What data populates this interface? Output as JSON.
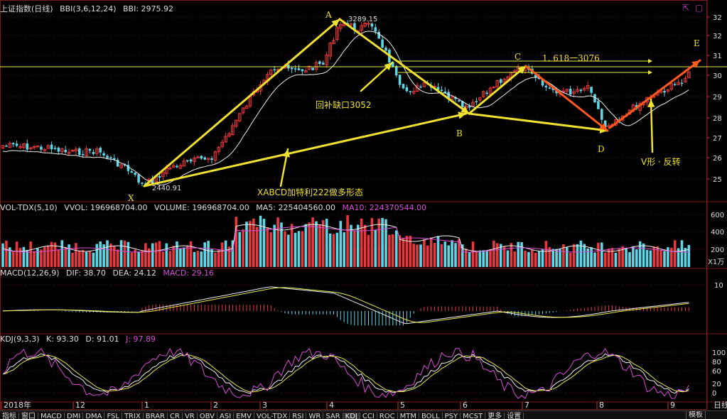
{
  "main_header": {
    "index_name": "上证指数(日线)",
    "indicator": "BBI(3,6,12,24)",
    "indicator_value": "BBI: 2975.92"
  },
  "vol_header": {
    "name": "VOL-TDX(5,10)",
    "vvol": "VVOL: 196968704.00",
    "volume": "VOLUME: 196968704.00",
    "ma5": "MA5: 225404560.00",
    "ma10": "MA10: 224370544.00"
  },
  "macd_header": {
    "name": "MACD(12,26,9)",
    "dif": "DIF: 38.70",
    "dea": "DEA: 24.12",
    "macd": "MACD: 29.16"
  },
  "kdj_header": {
    "name": "KDJ(9,3,3)",
    "k": "K: 93.30",
    "d": "D: 91.01",
    "j": "J: 97.89"
  },
  "price_axis_ticks": [
    "32",
    "32",
    "31",
    "30",
    "29",
    "28",
    "27",
    "26",
    "25"
  ],
  "vol_axis_ticks": [
    "600",
    "400",
    "200"
  ],
  "vol_axis_unit": "X1万",
  "macd_axis_ticks": [
    "10"
  ],
  "kdj_axis_ticks": [
    "100",
    "80",
    "60",
    "20",
    "0"
  ],
  "date_axis": {
    "labels": [
      "2018年",
      "12",
      "1",
      "2",
      "3",
      "4",
      "5",
      "6",
      "7",
      "8",
      "9"
    ],
    "right_label": "日线"
  },
  "annotations": {
    "point_x": "X",
    "point_a": "A",
    "point_b": "B",
    "point_c": "C",
    "point_d": "D",
    "point_e": "E",
    "low_value": "2440.91",
    "high_value": "3289.15",
    "gap_fill": "回补缺口3052",
    "fib_level": "1. 618一3076",
    "pattern": "XABCD加特利222做多形态",
    "reversal": "V形 · 反转"
  },
  "tabs": [
    "指标",
    "窗口",
    "MACD",
    "DMI",
    "DMA",
    "FSL",
    "TRIX",
    "BRAR",
    "CR",
    "VR",
    "OBV",
    "ASI",
    "EMV",
    "VOL-TDX",
    "RSI",
    "WR",
    "SAR",
    "KDJ",
    "CCI",
    "ROC",
    "MTM",
    "BOLL",
    "PSY",
    "MCST",
    "更多",
    "设置"
  ],
  "right_tab": "模板",
  "colors": {
    "up": "#e8383d",
    "down": "#5fd6e6",
    "yellow": "#f0e030",
    "orange": "#ff5a1e",
    "magenta": "#d64fd6",
    "grid": "#7a1a1a"
  },
  "chart_data": {
    "type": "line",
    "series": [
      {
        "name": "上证指数(日线)",
        "note_points": [
          {
            "label": "X",
            "value": 2440.91
          },
          {
            "label": "A",
            "value": 3289.15
          },
          {
            "label": "B",
            "value": 2830
          },
          {
            "label": "C",
            "value": 3050
          },
          {
            "label": "D",
            "value": 2730
          },
          {
            "label": "E",
            "value": 3076
          }
        ]
      }
    ],
    "indicators": {
      "BBI": 2975.92,
      "VOLUME": 196968704.0,
      "MA5": 225404560.0,
      "MA10": 224370544.0,
      "DIF": 38.7,
      "DEA": 24.12,
      "MACD": 29.16,
      "K": 93.3,
      "D": 91.01,
      "J": 97.89
    },
    "horizontal_levels": [
      3076,
      3052
    ]
  }
}
